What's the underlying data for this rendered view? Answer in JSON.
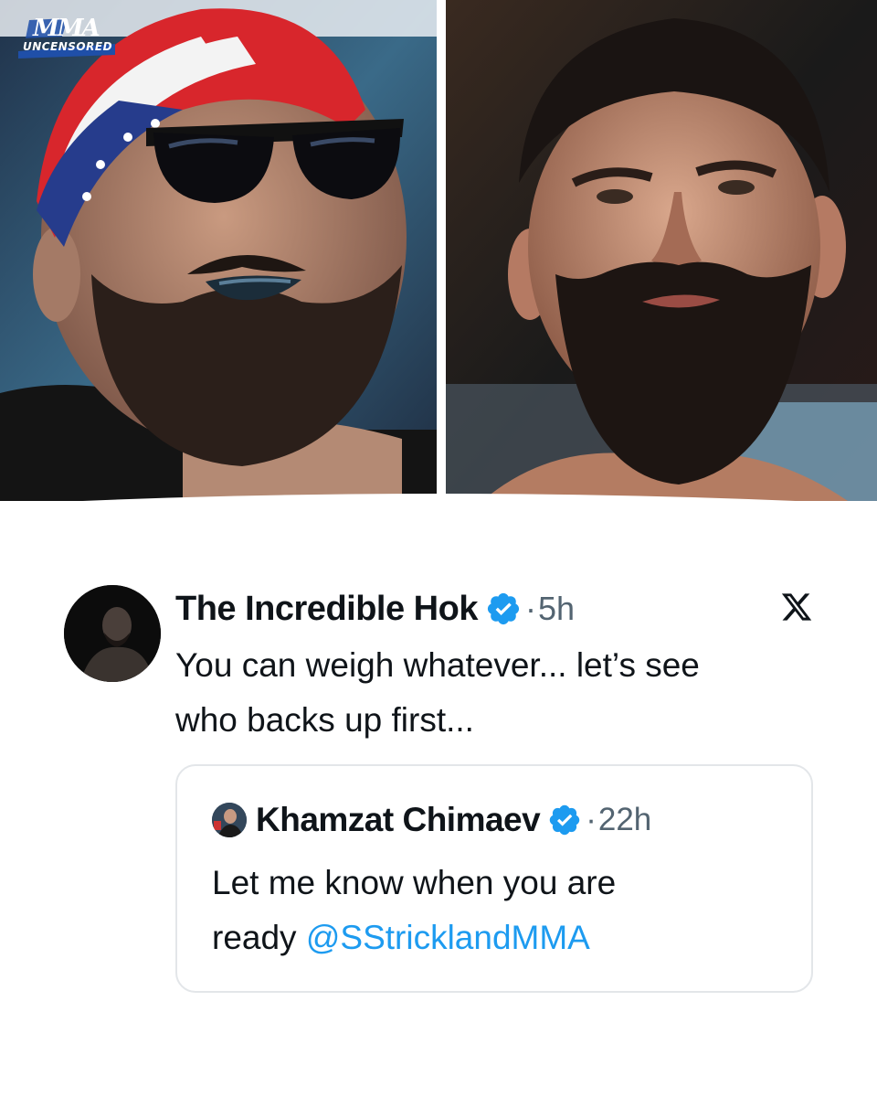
{
  "brand": {
    "logo_text": "UNCENSORED",
    "logo_mark": "MMA"
  },
  "tweet": {
    "display_name": "The Incredible Hok",
    "verified_icon": "verified-badge-icon",
    "separator": "·",
    "time": "5h",
    "platform_icon": "x-logo-icon",
    "text_line1": "You can weigh whatever... let’s see",
    "text_line2": "who backs up first..."
  },
  "quoted_tweet": {
    "display_name": "Khamzat Chimaev",
    "verified_icon": "verified-badge-icon",
    "separator": "·",
    "time": "22h",
    "text_line1": "Let me know when you are",
    "text_line2_prefix": "ready ",
    "mention": "@SStricklandMMA"
  },
  "colors": {
    "text": "#0f1419",
    "muted": "#536471",
    "verified": "#1d9bf0",
    "mention": "#1d9bf0",
    "border": "#e3e6e9"
  }
}
